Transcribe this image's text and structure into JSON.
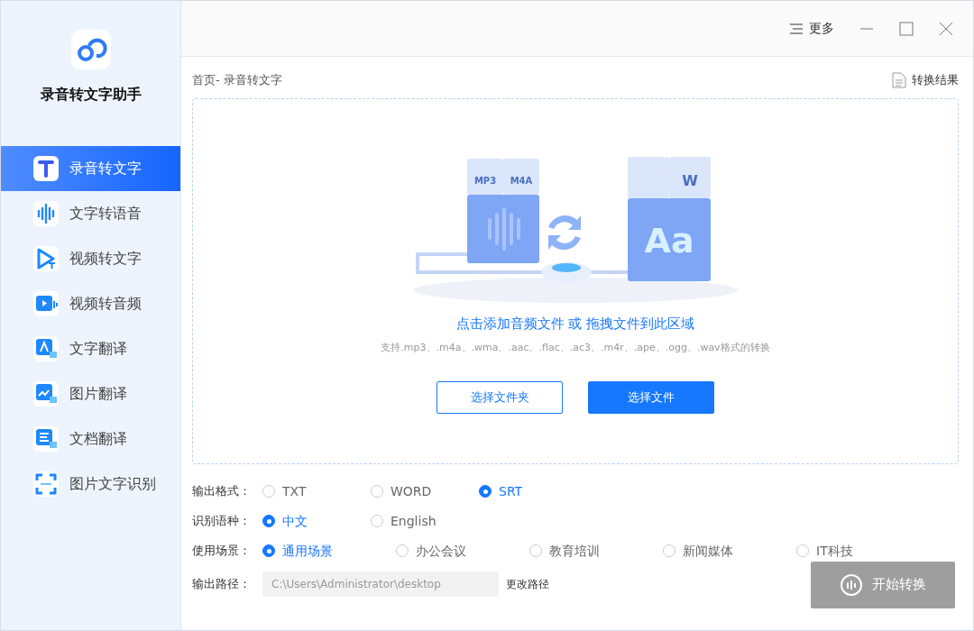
{
  "app": {
    "title": "录音转文字助手"
  },
  "sidebar": {
    "items": [
      {
        "label": "录音转文字",
        "kind": "t",
        "selected": true
      },
      {
        "label": "文字转语音",
        "kind": "wave",
        "selected": false
      },
      {
        "label": "视频转文字",
        "kind": "play",
        "selected": false
      },
      {
        "label": "视频转音频",
        "kind": "video",
        "selected": false
      },
      {
        "label": "文字翻译",
        "kind": "textzh",
        "selected": false
      },
      {
        "label": "图片翻译",
        "kind": "imgzh",
        "selected": false
      },
      {
        "label": "文档翻译",
        "kind": "doczh",
        "selected": false
      },
      {
        "label": "图片文字识别",
        "kind": "scan",
        "selected": false
      }
    ]
  },
  "titlebar": {
    "menu": "更多"
  },
  "breadcrumb": "首页- 录音转文字",
  "results_link": "转换结果",
  "dropzone": {
    "illustration": {
      "source_labels": [
        "MP3",
        "M4A"
      ],
      "doc_label": "W",
      "target_label": "Aa"
    },
    "prompt": "点击添加音频文件 或 拖拽文件到此区域",
    "hint": "支持.mp3、.m4a、.wma、.aac、.flac、.ac3、.m4r、.ape、.ogg、.wav格式的转换",
    "buttons": [
      {
        "label": "选择文件夹",
        "kind": "outline"
      },
      {
        "label": "选择文件",
        "kind": "primary"
      }
    ]
  },
  "options": [
    {
      "label": "输出格式：",
      "choices": [
        {
          "label": "TXT",
          "selected": false
        },
        {
          "label": "WORD",
          "selected": false
        },
        {
          "label": "SRT",
          "selected": true
        }
      ]
    },
    {
      "label": "识别语种：",
      "choices": [
        {
          "label": "中文",
          "selected": true
        },
        {
          "label": "English",
          "selected": false
        }
      ]
    },
    {
      "label": "使用场景：",
      "choices": [
        {
          "label": "通用场景",
          "selected": true
        },
        {
          "label": "办公会议",
          "selected": false
        },
        {
          "label": "教育培训",
          "selected": false
        },
        {
          "label": "新闻媒体",
          "selected": false
        },
        {
          "label": "IT科技",
          "selected": false
        }
      ]
    }
  ],
  "output_path": {
    "label": "输出路径：",
    "value": "C:\\Users\\Administrator\\desktop",
    "change": "更改路径"
  },
  "start_button": {
    "label": "开始转换",
    "disabled": true
  }
}
